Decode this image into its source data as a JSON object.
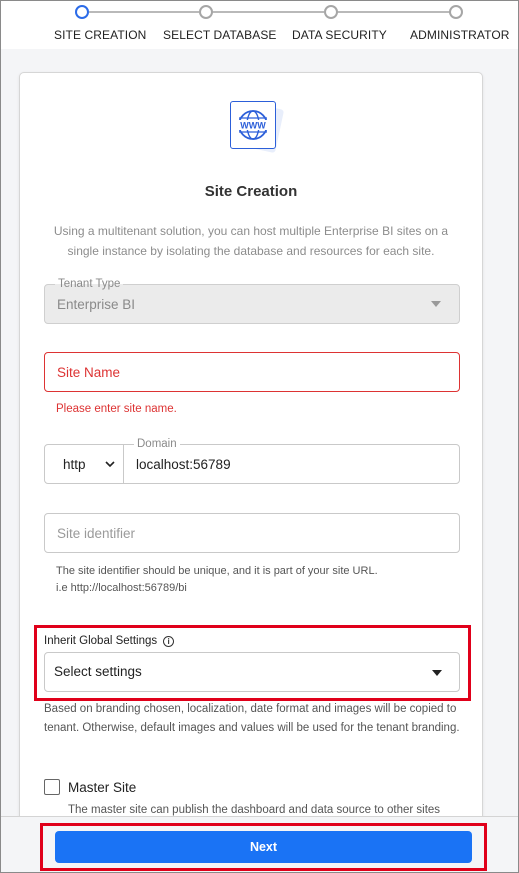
{
  "stepper": {
    "steps": [
      {
        "label": "SITE CREATION"
      },
      {
        "label": "SELECT DATABASE"
      },
      {
        "label": "DATA SECURITY"
      },
      {
        "label": "ADMINISTRATOR"
      }
    ],
    "active_index": 0
  },
  "card": {
    "logo_text": "WWW",
    "title": "Site Creation",
    "description": "Using a multitenant solution, you can host multiple Enterprise BI sites on a single instance by isolating the database and resources for each site."
  },
  "tenant_type": {
    "label": "Tenant Type",
    "value": "Enterprise BI"
  },
  "site_name": {
    "placeholder": "Site Name",
    "error": "Please enter site name."
  },
  "protocol": {
    "value": "http"
  },
  "domain": {
    "label": "Domain",
    "value": "localhost:56789"
  },
  "site_identifier": {
    "placeholder": "Site identifier",
    "hint_line1": "The site identifier should be unique, and it is part of your site URL.",
    "hint_line2": "i.e http://localhost:56789/bi"
  },
  "inherit_settings": {
    "label": "Inherit Global Settings",
    "value": "Select settings",
    "note": "Based on branding chosen, localization, date format and images will be copied to tenant. Otherwise, default images and values will be used for the tenant branding."
  },
  "master_site": {
    "label": "Master Site",
    "description": "The master site can publish the dashboard and data source to other sites"
  },
  "footer": {
    "next_label": "Next"
  },
  "colors": {
    "accent": "#1a73f5",
    "error": "#dd3333",
    "highlight": "#e0001a"
  }
}
